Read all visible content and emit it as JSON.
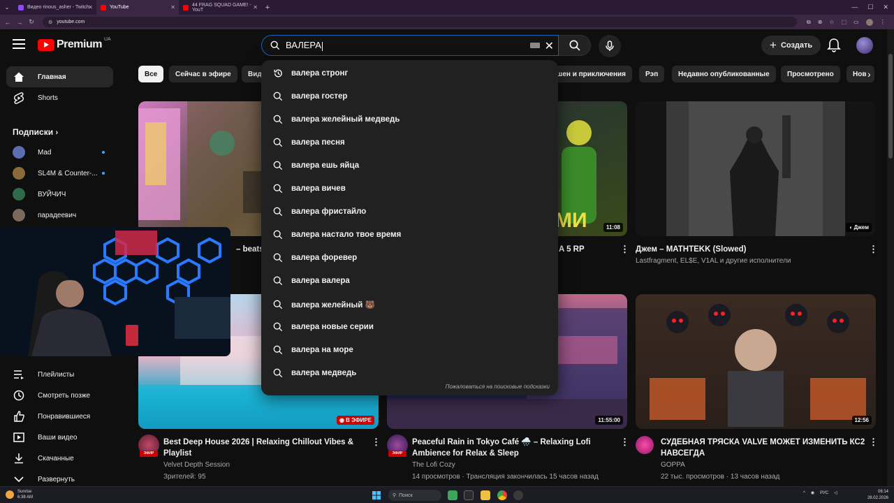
{
  "browser": {
    "tabs": [
      {
        "title": "Видео rinous_asher - Twitch",
        "close": "✕"
      },
      {
        "title": "YouTube",
        "close": "✕"
      },
      {
        "title": "44 FRAG SQUAD GAME! - YouT",
        "close": "✕"
      }
    ],
    "new_tab": "+",
    "url": "youtube.com"
  },
  "header": {
    "logo_text": "Premium",
    "region": "UA",
    "search_query": "ВАЛЕРА",
    "create_label": "Создать"
  },
  "sidebar": {
    "main": [
      {
        "label": "Главная",
        "icon": "home-icon"
      },
      {
        "label": "Shorts",
        "icon": "shorts-icon"
      }
    ],
    "subscriptions_heading": "Подписки",
    "subscriptions": [
      {
        "label": "Mad",
        "live": true,
        "color": "#5b6fb0"
      },
      {
        "label": "SL4M & Counter-...",
        "live": true,
        "color": "#8a6a3a"
      },
      {
        "label": "ВУЙЧИЧ",
        "live": false,
        "color": "#2f6b4a"
      },
      {
        "label": "парадеевич",
        "live": false,
        "color": "#7a6a5e"
      }
    ],
    "you": [
      {
        "label": "Плейлисты",
        "icon": "playlist-icon"
      },
      {
        "label": "Смотреть позже",
        "icon": "clock-icon"
      },
      {
        "label": "Понравившиеся",
        "icon": "thumb-up-icon"
      },
      {
        "label": "Ваши видео",
        "icon": "your-videos-icon"
      },
      {
        "label": "Скачанные",
        "icon": "download-icon"
      },
      {
        "label": "Развернуть",
        "icon": "chevron-down-icon"
      }
    ]
  },
  "chips": [
    "Все",
    "Сейчас в эфире",
    "Вид",
    "шен и приключения",
    "Рэп",
    "Недавно опубликованные",
    "Просмотрено",
    "Нов"
  ],
  "suggestions": {
    "items": [
      {
        "text": "валера стронг",
        "icon": "history-icon"
      },
      {
        "text": "валера гостер",
        "icon": "search-icon"
      },
      {
        "text": "валера желейный медведь",
        "icon": "search-icon"
      },
      {
        "text": "валера песня",
        "icon": "search-icon"
      },
      {
        "text": "валера ешь яйца",
        "icon": "search-icon"
      },
      {
        "text": "валера вичев",
        "icon": "search-icon"
      },
      {
        "text": "валера фристайло",
        "icon": "search-icon"
      },
      {
        "text": "валера настало твое время",
        "icon": "search-icon"
      },
      {
        "text": "валера форевер",
        "icon": "search-icon"
      },
      {
        "text": "валера валера",
        "icon": "search-icon"
      },
      {
        "text": "валера желейный 🐻",
        "icon": "search-icon"
      },
      {
        "text": "валера новые серии",
        "icon": "search-icon"
      },
      {
        "text": "валера на море",
        "icon": "search-icon"
      },
      {
        "text": "валера медведь",
        "icon": "search-icon"
      }
    ],
    "report": "Пожаловаться на поисковые подсказки"
  },
  "videos_row1": [
    {
      "title_fragment": "– beats t"
    },
    {
      "duration": "11:08",
      "title_fragment": "A 5 RP",
      "overlay_text": "МИ"
    },
    {
      "duration_label": "Джем",
      "title": "Джем – MATHTEKK (Slowed)",
      "channel": "Lastfragment, EL$E, V1AL и другие исполнители"
    }
  ],
  "videos_row2": [
    {
      "badge": "В ЭФИРЕ",
      "title": "Best Deep House 2026 | Relaxing Chillout Vibes & Playlist",
      "channel": "Velvet Depth Session",
      "meta": "Зрителей: 95",
      "live_tag": "ЭФИР"
    },
    {
      "duration": "11:55:00",
      "title": "Peaceful Rain in Tokyo Café 🌧️ – Relaxing Lofi Ambience for Relax & Sleep",
      "channel": "The Lofi Cozy",
      "meta": "14 просмотров · Трансляция закончилась 15 часов назад",
      "live_tag": "ЭФИР"
    },
    {
      "duration": "12:56",
      "title": "СУДЕБНАЯ ТРЯСКА VALVE МОЖЕТ ИЗМЕНИТЬ КС2 НАВСЕГДА",
      "channel": "GOPPA",
      "meta": "22 тыс. просмотров · 13 часов назад"
    }
  ],
  "taskbar": {
    "weather_title": "Sunrise",
    "weather_time": "6:38 AM",
    "search_placeholder": "Поиск",
    "lang": "РУС",
    "time": "06:14",
    "date": "28.02.2026"
  },
  "colors": {
    "accent": "#ff0000",
    "link_blue": "#3ea6ff",
    "live_red": "#cc0000"
  }
}
